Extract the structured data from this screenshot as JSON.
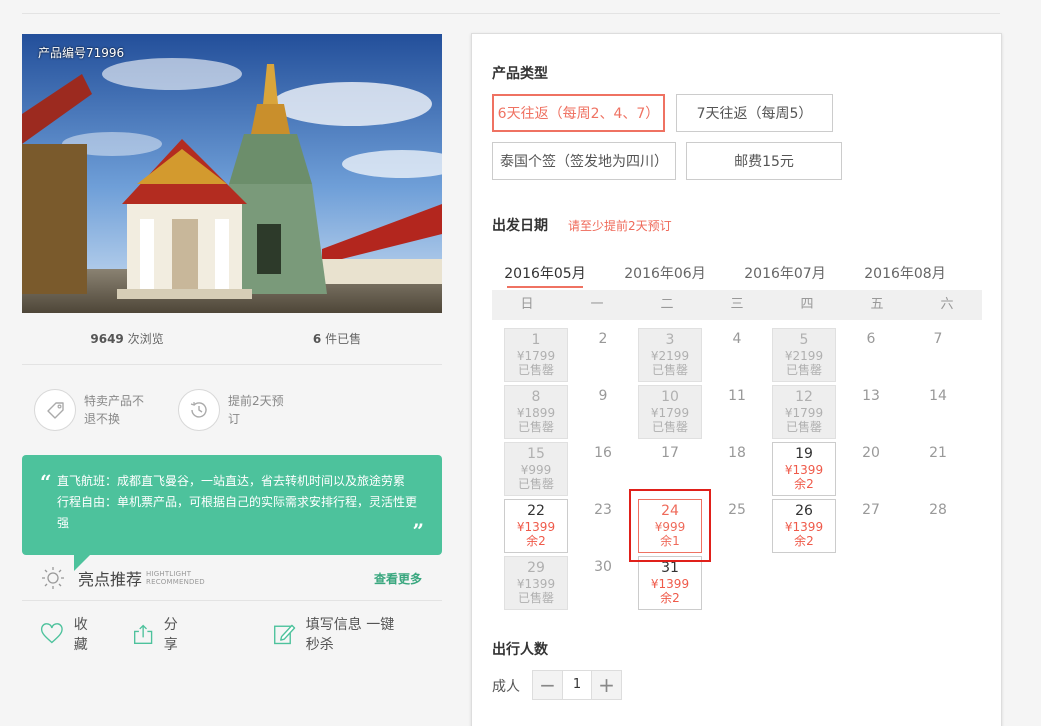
{
  "product": {
    "code_label": "产品编号71996",
    "views_num": "9649",
    "views_label": "次浏览",
    "sold_num": "6",
    "sold_label": "件已售"
  },
  "features": [
    {
      "icon": "tag-icon",
      "text": "特卖产品不退不换"
    },
    {
      "icon": "clock-history-icon",
      "text": "提前2天预订"
    }
  ],
  "highlights": {
    "lines": [
      "直飞航班：成都直飞曼谷，一站直达，省去转机时间以及旅途劳累",
      "行程自由：单机票产品，可根据自己的实际需求安排行程，灵活性更强"
    ],
    "open_quote": "“",
    "close_quote": "”",
    "title": "亮点推荐",
    "subtitle_1": "HIGHTLIGHT",
    "subtitle_2": "RECOMMENDED",
    "more": "查看更多"
  },
  "actions": {
    "favorite": "收藏",
    "share": "分享",
    "quick_buy": "填写信息 一键秒杀"
  },
  "booking": {
    "product_type_title": "产品类型",
    "options": [
      "6天往返（每周2、4、7）",
      "7天往返（每周5）",
      "泰国个签（签发地为四川）",
      "邮费15元"
    ],
    "selected_option": 0,
    "date_title": "出发日期",
    "date_note": "请至少提前2天预订",
    "months": [
      "2016年05月",
      "2016年06月",
      "2016年07月",
      "2016年08月"
    ],
    "active_month": "2016年05月",
    "weekdays": [
      "日",
      "一",
      "二",
      "三",
      "四",
      "五",
      "六"
    ],
    "days": [
      {
        "d": "1",
        "price": "¥1799",
        "stock": "已售罄",
        "state": "soldout"
      },
      {
        "d": "2",
        "state": "plain"
      },
      {
        "d": "3",
        "price": "¥2199",
        "stock": "已售罄",
        "state": "soldout"
      },
      {
        "d": "4",
        "state": "plain"
      },
      {
        "d": "5",
        "price": "¥2199",
        "stock": "已售罄",
        "state": "soldout"
      },
      {
        "d": "6",
        "state": "plain"
      },
      {
        "d": "7",
        "state": "plain"
      },
      {
        "d": "8",
        "price": "¥1899",
        "stock": "已售罄",
        "state": "soldout"
      },
      {
        "d": "9",
        "state": "plain"
      },
      {
        "d": "10",
        "price": "¥1799",
        "stock": "已售罄",
        "state": "soldout"
      },
      {
        "d": "11",
        "state": "plain"
      },
      {
        "d": "12",
        "price": "¥1799",
        "stock": "已售罄",
        "state": "soldout"
      },
      {
        "d": "13",
        "state": "plain"
      },
      {
        "d": "14",
        "state": "plain"
      },
      {
        "d": "15",
        "price": "¥999",
        "stock": "已售罄",
        "state": "soldout"
      },
      {
        "d": "16",
        "state": "plain"
      },
      {
        "d": "17",
        "state": "plain"
      },
      {
        "d": "18",
        "state": "plain"
      },
      {
        "d": "19",
        "price": "¥1399",
        "stock": "余2",
        "state": "avail"
      },
      {
        "d": "20",
        "state": "plain"
      },
      {
        "d": "21",
        "state": "plain"
      },
      {
        "d": "22",
        "price": "¥1399",
        "stock": "余2",
        "state": "avail"
      },
      {
        "d": "23",
        "state": "plain"
      },
      {
        "d": "24",
        "price": "¥999",
        "stock": "余1",
        "state": "sel"
      },
      {
        "d": "25",
        "state": "plain"
      },
      {
        "d": "26",
        "price": "¥1399",
        "stock": "余2",
        "state": "avail"
      },
      {
        "d": "27",
        "state": "plain"
      },
      {
        "d": "28",
        "state": "plain"
      },
      {
        "d": "29",
        "price": "¥1399",
        "stock": "已售罄",
        "state": "soldout"
      },
      {
        "d": "30",
        "state": "plain"
      },
      {
        "d": "31",
        "price": "¥1399",
        "stock": "余2",
        "state": "avail"
      }
    ],
    "travelers_title": "出行人数",
    "adult_label": "成人",
    "adult_count": "1",
    "minus": "−",
    "plus": "+"
  },
  "colors": {
    "accent": "#ef7262",
    "green": "#4dc29c",
    "selection_frame": "#e0201a"
  }
}
